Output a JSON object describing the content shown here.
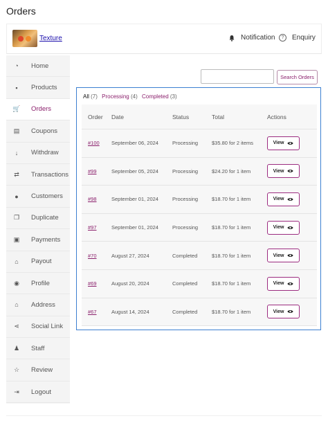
{
  "page": {
    "title": "Orders"
  },
  "header": {
    "store_name": "Texture",
    "notification_label": "Notification",
    "enquiry_label": "Enquiry"
  },
  "sidebar": {
    "items": [
      {
        "label": "Home",
        "icon": "dashboard-icon",
        "active": false
      },
      {
        "label": "Products",
        "icon": "briefcase-icon",
        "active": false
      },
      {
        "label": "Orders",
        "icon": "cart-icon",
        "active": true
      },
      {
        "label": "Coupons",
        "icon": "gift-icon",
        "active": false
      },
      {
        "label": "Withdraw",
        "icon": "arrow-down-icon",
        "active": false
      },
      {
        "label": "Transactions",
        "icon": "exchange-icon",
        "active": false
      },
      {
        "label": "Customers",
        "icon": "user-icon",
        "active": false
      },
      {
        "label": "Duplicate",
        "icon": "copy-icon",
        "active": false
      },
      {
        "label": "Payments",
        "icon": "id-card-icon",
        "active": false
      },
      {
        "label": "Payout",
        "icon": "bank-icon",
        "active": false
      },
      {
        "label": "Profile",
        "icon": "profile-icon",
        "active": false
      },
      {
        "label": "Address",
        "icon": "house-icon",
        "active": false
      },
      {
        "label": "Social Link",
        "icon": "share-icon",
        "active": false
      },
      {
        "label": "Staff",
        "icon": "staff-icon",
        "active": false
      },
      {
        "label": "Review",
        "icon": "star-icon",
        "active": false
      },
      {
        "label": "Logout",
        "icon": "logout-icon",
        "active": false
      }
    ]
  },
  "search": {
    "value": "",
    "placeholder": "",
    "button_label": "Search Orders"
  },
  "filters": [
    {
      "label": "All",
      "count": "(7)"
    },
    {
      "label": "Processing",
      "count": "(4)"
    },
    {
      "label": "Completed",
      "count": "(3)"
    }
  ],
  "table": {
    "headers": {
      "order": "Order",
      "date": "Date",
      "status": "Status",
      "total": "Total",
      "actions": "Actions"
    },
    "rows": [
      {
        "order": "#100",
        "date": "September 06, 2024",
        "status": "Processing",
        "total": "$35.80 for 2 items",
        "action": "View"
      },
      {
        "order": "#99",
        "date": "September 05, 2024",
        "status": "Processing",
        "total": "$24.20 for 1 item",
        "action": "View"
      },
      {
        "order": "#98",
        "date": "September 01, 2024",
        "status": "Processing",
        "total": "$18.70 for 1 item",
        "action": "View"
      },
      {
        "order": "#97",
        "date": "September 01, 2024",
        "status": "Processing",
        "total": "$18.70 for 1 item",
        "action": "View"
      },
      {
        "order": "#70",
        "date": "August 27, 2024",
        "status": "Completed",
        "total": "$18.70 for 1 item",
        "action": "View"
      },
      {
        "order": "#69",
        "date": "August 20, 2024",
        "status": "Completed",
        "total": "$18.70 for 1 item",
        "action": "View"
      },
      {
        "order": "#67",
        "date": "August 14, 2024",
        "status": "Completed",
        "total": "$18.70 for 1 item",
        "action": "View"
      }
    ]
  },
  "colors": {
    "accent": "#8a1e6b",
    "highlight_border": "#3b7fd1",
    "sidebar_bg": "#f4f4f4"
  }
}
